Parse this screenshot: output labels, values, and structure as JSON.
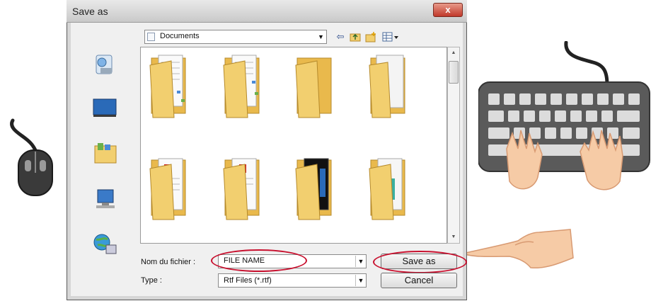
{
  "dialog": {
    "title": "Save as",
    "close_glyph": "x",
    "look_in": "Documents"
  },
  "toolbar_icons": [
    "back-icon",
    "up-folder-icon",
    "new-folder-icon",
    "view-menu-icon"
  ],
  "places_bar": [
    "recent-places-icon",
    "desktop-icon",
    "libraries-icon",
    "computer-icon",
    "network-icon"
  ],
  "files": [
    {
      "icon": "folder-with-documents-icon"
    },
    {
      "icon": "folder-with-documents-icon"
    },
    {
      "icon": "folder-icon"
    },
    {
      "icon": "folder-with-document-icon"
    },
    {
      "icon": "folder-with-pdf-icon"
    },
    {
      "icon": "folder-with-pdf-icon"
    },
    {
      "icon": "folder-with-media-icon"
    },
    {
      "icon": "folder-with-document-icon"
    }
  ],
  "filename": {
    "label": "Nom du fichier :",
    "value": "FILE NAME"
  },
  "filetype": {
    "label": "Type :",
    "value": "Rtf Files (*.rtf)"
  },
  "buttons": {
    "save": "Save as",
    "cancel": "Cancel"
  },
  "illustrations": [
    "mouse-illustration",
    "keyboard-illustration",
    "typing-hands-illustration",
    "pointing-hand-illustration"
  ],
  "colors": {
    "highlight": "#c8102e",
    "folder": "#f2cf6f",
    "keyboard": "#5a5a5a"
  }
}
